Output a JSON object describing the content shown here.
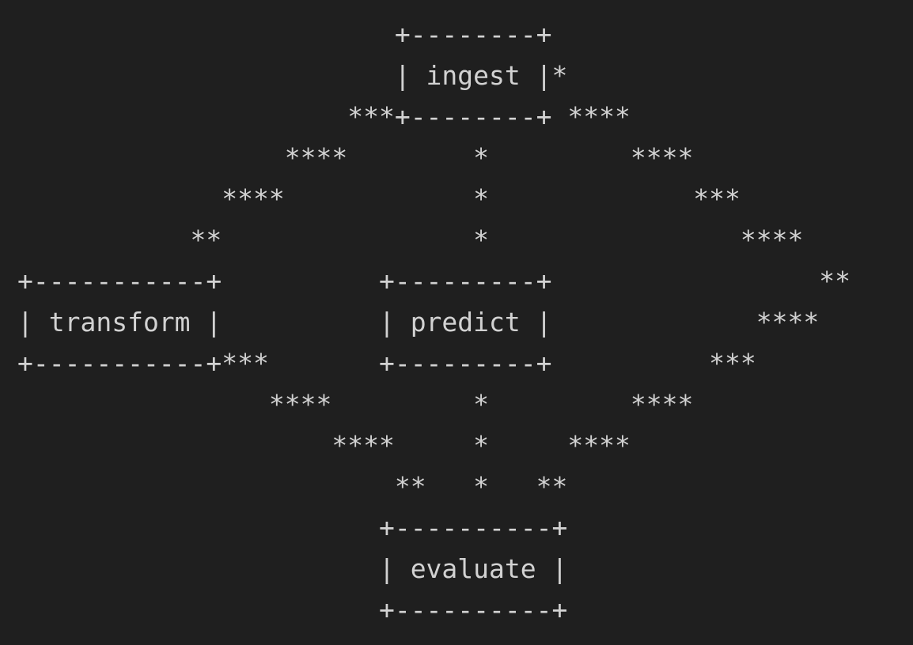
{
  "diagram": {
    "lines": [
      "                        +--------+",
      "                        | ingest |*",
      "                     ***+--------+ ****",
      "                 ****        *         ****",
      "             ****            *             ***",
      "           **                *                ****",
      "+-----------+          +---------+                 **",
      "| transform |          | predict |             ****",
      "+-----------+***       +---------+          ***",
      "                ****         *         ****",
      "                    ****     *     ****",
      "                        **   *   **",
      "                       +----------+",
      "                       | evaluate |",
      "                       +----------+"
    ],
    "nodes": [
      "ingest",
      "transform",
      "predict",
      "evaluate"
    ],
    "colors": {
      "background": "#1f1f1f",
      "text": "#d2d2d2"
    }
  }
}
